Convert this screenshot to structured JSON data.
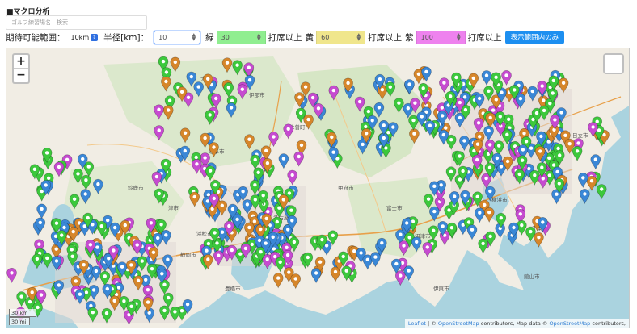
{
  "title": "■マクロ分析",
  "search": {
    "placeholder": "ゴルフ練習場名　検索"
  },
  "controls": {
    "range_label": "期待可能範囲：",
    "range_value": "10km",
    "radius_label": "半径[km]：",
    "radius_value": "10",
    "green_label": "緑",
    "green_value": "30",
    "green_color": "#90ee90",
    "green_suffix": "打席以上",
    "yellow_label": "黄",
    "yellow_value": "60",
    "yellow_color": "#f0e68c",
    "yellow_suffix": "打席以上",
    "purple_label": "紫",
    "purple_value": "100",
    "purple_color": "#ee82ee",
    "purple_suffix": "打席以上",
    "apply_button": "表示範囲内のみ"
  },
  "map": {
    "zoom_in": "+",
    "zoom_out": "−",
    "scale_km": "30 km",
    "scale_mi": "30 mi",
    "attribution_leaflet": "Leaflet",
    "attribution_sep1": " | © ",
    "attribution_osm1": "OpenStreetMap",
    "attribution_mid": " contributors, Map data © ",
    "attribution_osm2": "OpenStreetMap",
    "attribution_end": " contributors,",
    "marker_colors": {
      "blue": "#3a87d6",
      "green": "#3cc83c",
      "orange": "#d6862a",
      "purple": "#c64bd0"
    },
    "place_labels": [
      "静岡市",
      "浜松市",
      "豊橋市",
      "名古屋市",
      "岐阜市",
      "甲府市",
      "富士市",
      "沼津市",
      "伊東市",
      "館山市",
      "千葉市",
      "横浜市",
      "鈴鹿市",
      "津市",
      "木曽町",
      "伊那市",
      "大町市",
      "日立市"
    ]
  }
}
